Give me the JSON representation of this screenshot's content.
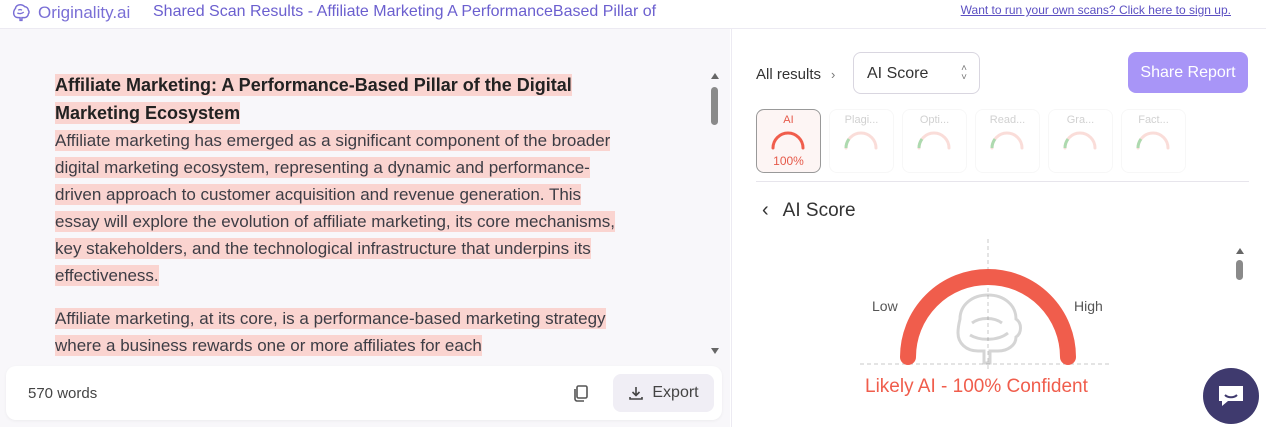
{
  "header": {
    "brand": "Originality.ai",
    "doc_title": "Shared Scan Results - Affiliate Marketing A PerformanceBased Pillar of",
    "signup_link": "Want to run your own scans? Click here to sign up."
  },
  "document": {
    "heading_line1": "Affiliate Marketing: A Performance-Based Pillar of the Digital",
    "heading_line2": "Marketing Ecosystem",
    "paragraphs": [
      "Affiliate marketing has emerged as a significant component of the broader digital marketing ecosystem, representing a dynamic and performance-driven approach to customer acquisition and revenue generation. This essay will explore the evolution of affiliate marketing, its core mechanisms, key stakeholders, and the technological infrastructure that underpins its effectiveness.",
      "Affiliate marketing, at its core, is a performance-based marketing strategy where a business rewards one or more affiliates for each"
    ],
    "highlight_color": "#fad4d0"
  },
  "footer": {
    "word_count": "570 words",
    "export_label": "Export",
    "copy_icon": "copy-icon",
    "export_icon": "download-icon"
  },
  "results": {
    "breadcrumb": "All results",
    "selected_view": "AI Score",
    "share_label": "Share Report",
    "accent": "#a895f7",
    "tabs": [
      {
        "label": "AI",
        "value": "100%",
        "active": true
      },
      {
        "label": "Plagi...",
        "value": "",
        "active": false
      },
      {
        "label": "Opti...",
        "value": "",
        "active": false
      },
      {
        "label": "Read...",
        "value": "",
        "active": false
      },
      {
        "label": "Gra...",
        "value": "",
        "active": false
      },
      {
        "label": "Fact...",
        "value": "",
        "active": false
      }
    ],
    "section_title": "AI Score",
    "gauge": {
      "low_label": "Low",
      "high_label": "High",
      "score_fraction": 1.0,
      "color": "#f05d4c"
    },
    "verdict": "Likely AI - 100% Confident"
  }
}
